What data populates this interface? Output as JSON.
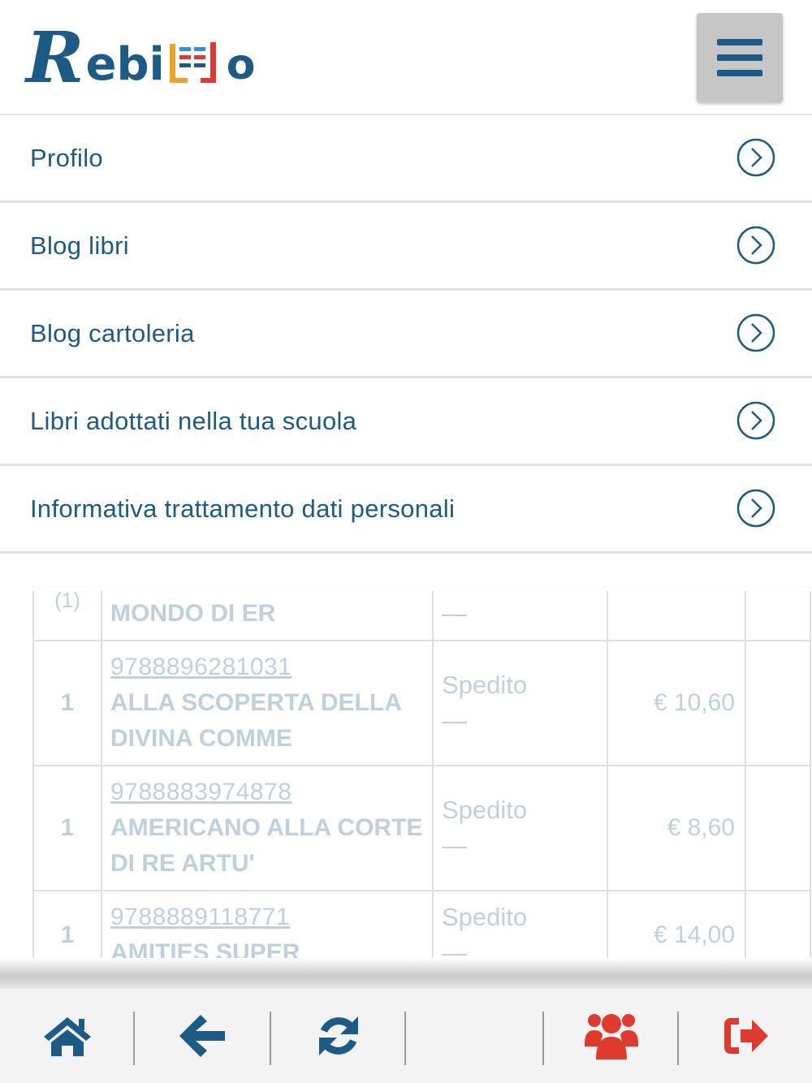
{
  "header": {
    "logo_text": "Rebiuso",
    "menu_button": "hamburger-icon"
  },
  "menu": {
    "items": [
      {
        "label": "Profilo"
      },
      {
        "label": "Blog libri"
      },
      {
        "label": "Blog cartoleria"
      },
      {
        "label": "Libri adottati nella tua scuola"
      },
      {
        "label": "Informativa trattamento dati personali"
      }
    ]
  },
  "orders": {
    "rows": [
      {
        "qty": "(1)",
        "isbn": "",
        "title_line1": "MONDO DI ER",
        "title_line2": "",
        "status": "—",
        "price": ""
      },
      {
        "qty": "1",
        "isbn": "9788896281031",
        "title_line1": "ALLA SCOPERTA DELLA",
        "title_line2": "DIVINA COMME",
        "status": "Spedito",
        "status_dash": "—",
        "price": "€ 10,60"
      },
      {
        "qty": "1",
        "isbn": "9788883974878",
        "title_line1": "AMERICANO ALLA CORTE",
        "title_line2": "DI RE ARTU'",
        "status": "Spedito",
        "status_dash": "—",
        "price": "€ 8,60"
      },
      {
        "qty": "1",
        "isbn": "9788889118771",
        "title_line1": "AMITIES SUPER",
        "title_line2": "",
        "status": "Spedito",
        "status_dash": "—",
        "price": "€ 14,00"
      }
    ]
  },
  "bottom_nav": {
    "items": [
      "home-icon",
      "back-arrow-icon",
      "refresh-icon",
      "empty-slot",
      "group-icon",
      "logout-icon"
    ]
  },
  "colors": {
    "primary": "#1c5b86",
    "accent_red": "#e03a2f",
    "menu_button_bg": "#c6c6c6"
  }
}
